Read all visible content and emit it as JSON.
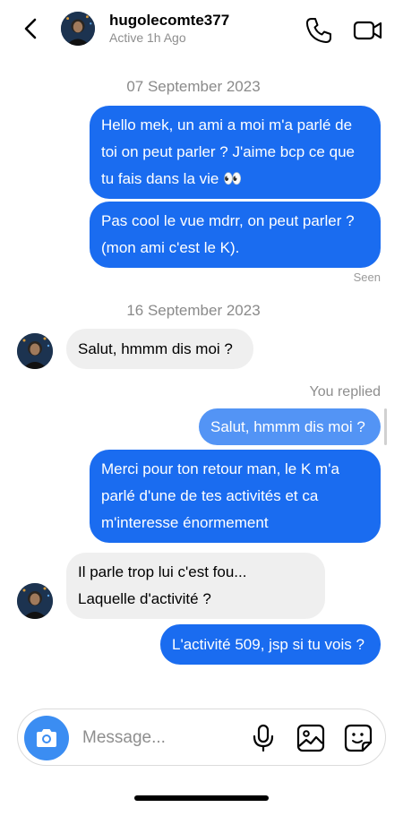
{
  "header": {
    "username": "hugolecomte377",
    "status": "Active 1h Ago"
  },
  "icons": {
    "back": "chevron-left-icon",
    "call": "phone-icon",
    "video": "video-camera-icon",
    "camera": "camera-icon",
    "mic": "microphone-icon",
    "gallery": "image-icon",
    "sticker": "sticker-icon"
  },
  "colors": {
    "outgoing_bubble": "#1a6cf0",
    "incoming_bubble": "#efefef",
    "camera_button": "#3b8df2"
  },
  "conversation": {
    "date1": "07 September 2023",
    "msg1": {
      "line1": "Hello mek, un ami a moi m'a parlé de",
      "line2": "toi on peut parler ? J'aime bcp ce que",
      "line3": "tu fais dans la vie 👀"
    },
    "msg2": {
      "line1": "Pas cool le vue mdrr, on peut parler ?",
      "line2": "(mon ami c'est le K)."
    },
    "seen": "Seen",
    "date2": "16 September 2023",
    "msg3": "Salut, hmmm dis moi ?",
    "replied_label": "You replied",
    "reply_quote": "Salut, hmmm dis moi ?",
    "msg4": {
      "line1": "Merci pour ton retour man, le K m'a",
      "line2": "parlé d'une de tes activités et ca",
      "line3": "m'interesse énormement"
    },
    "msg5": {
      "line1": "Il parle trop lui c'est fou...",
      "line2": "Laquelle d'activité ?"
    },
    "msg6": "L'activité 509, jsp si tu vois ?"
  },
  "composer": {
    "placeholder": "Message..."
  }
}
